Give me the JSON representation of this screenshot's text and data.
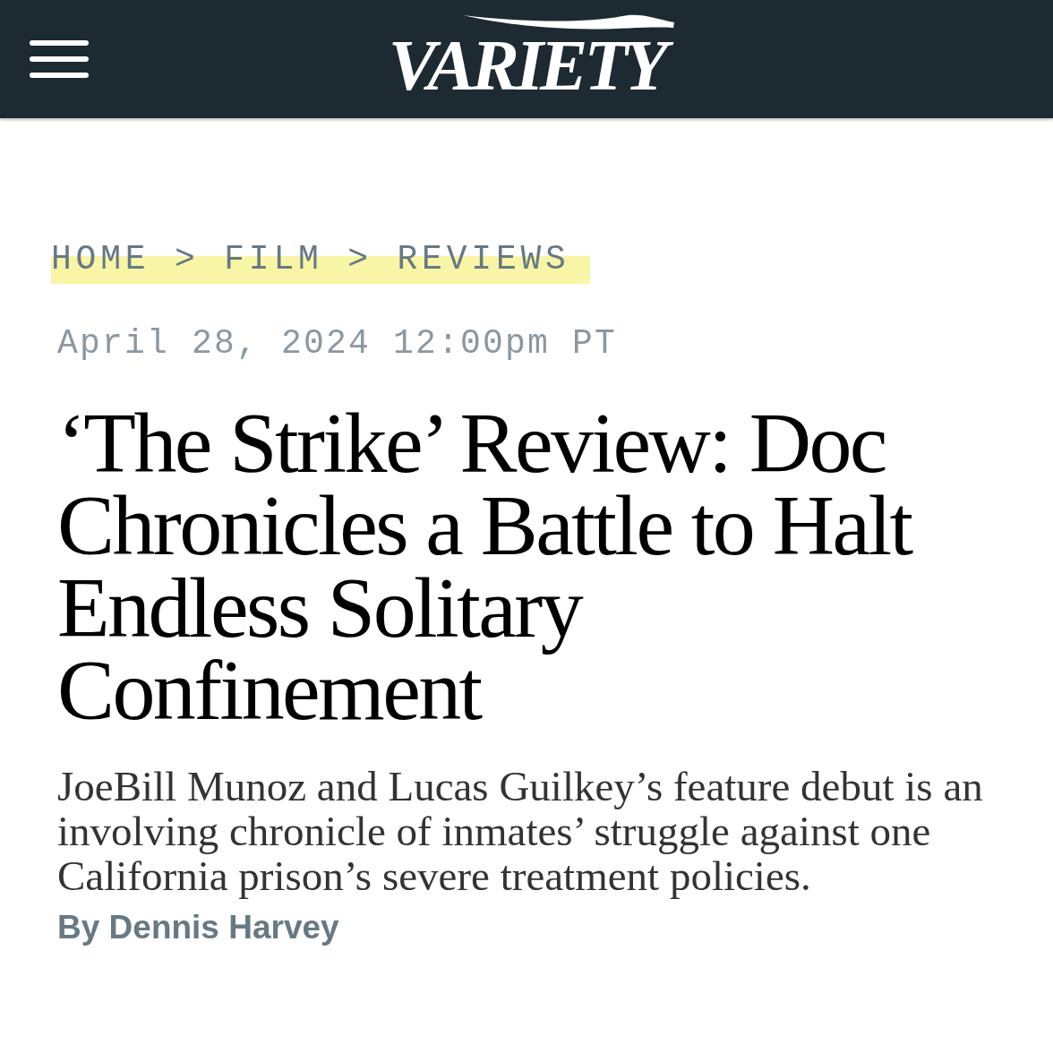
{
  "header": {
    "logo": "VARIETY"
  },
  "breadcrumbs": [
    {
      "label": "HOME",
      "separator": ">"
    },
    {
      "label": "FILM",
      "separator": ">"
    },
    {
      "label": "REVIEWS"
    }
  ],
  "article": {
    "date": "April 28, 2024 12:00pm PT",
    "headline": "‘The Strike’ Review: Doc Chronicles a Battle to Halt Endless Solitary Confinement",
    "dek": "JoeBill Munoz and Lucas Guilkey’s feature debut is an involving chronicle of inmates’ struggle against one California prison’s severe treatment policies.",
    "byline": {
      "prefix": "By",
      "author": "Dennis Harvey"
    }
  }
}
